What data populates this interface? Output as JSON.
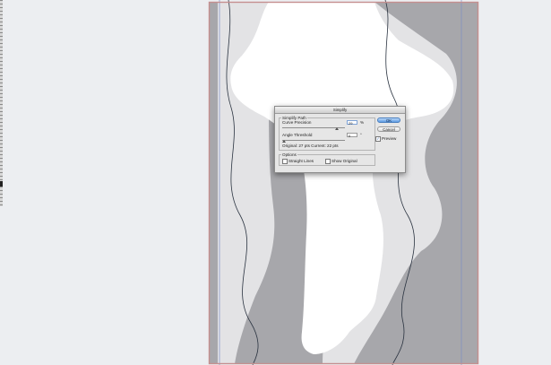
{
  "dialog": {
    "title": "Simplify",
    "simplify_path_group": "Simplify Path",
    "curve_precision_label": "Curve Precision",
    "curve_precision_value": "29",
    "curve_precision_unit": "%",
    "angle_threshold_label": "Angle Threshold",
    "angle_threshold_value": "0",
    "angle_threshold_unit": "°",
    "points_info": "Original: 27 pts   Current: 22 pts",
    "options_group": "Options",
    "straight_lines_label": "Straight Lines",
    "show_original_label": "Show Original",
    "ok_label": "OK",
    "cancel_label": "Cancel",
    "preview_label": "Preview",
    "preview_checked": "✓"
  },
  "colors": {
    "canvas_bg": "#eceef1",
    "artboard_dark": "#a7a7ab",
    "artboard_light": "#e3e3e5",
    "shape_white": "#ffffff",
    "artboard_border": "#c58f8f",
    "guide_blue": "#7e8fc6",
    "path_stroke": "#2a3340"
  },
  "icons": {
    "ok_default": "default-button",
    "checkbox": "checkbox-icon",
    "slider": "slider-thumb-icon"
  }
}
